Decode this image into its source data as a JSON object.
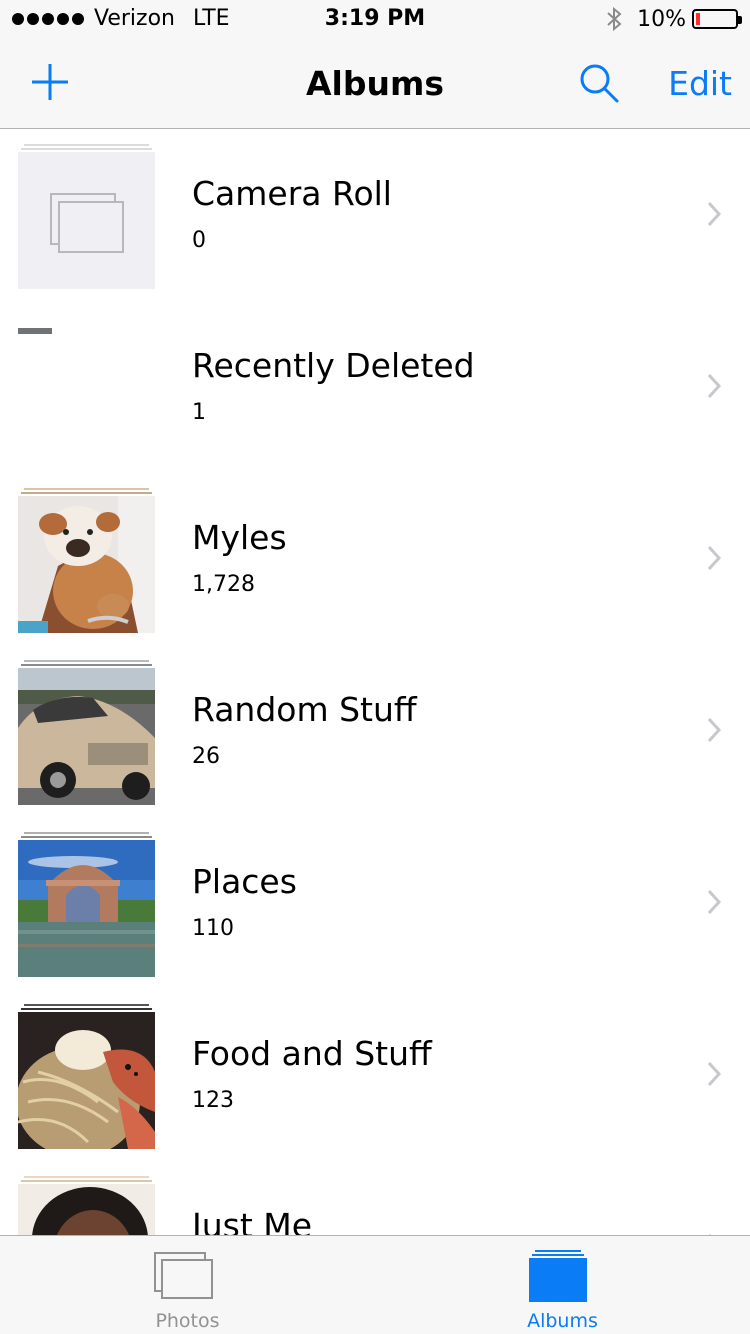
{
  "status_bar": {
    "carrier": "Verizon",
    "network": "LTE",
    "time": "3:19 PM",
    "battery": "10%",
    "battery_level": 0.1,
    "signal_bars": 5
  },
  "nav": {
    "title": "Albums",
    "edit_label": "Edit",
    "add_icon": "plus-icon",
    "search_icon": "search-icon"
  },
  "albums": [
    {
      "name": "Camera Roll",
      "count": "0",
      "thumbnail": "empty-placeholder"
    },
    {
      "name": "Recently Deleted",
      "count": "1",
      "thumbnail": "blank"
    },
    {
      "name": "Myles",
      "count": "1,728",
      "thumbnail": "bulldog-puppy-photo"
    },
    {
      "name": "Random Stuff",
      "count": "26",
      "thumbnail": "silver-car-photo"
    },
    {
      "name": "Places",
      "count": "110",
      "thumbnail": "domed-building-by-water-photo"
    },
    {
      "name": "Food and Stuff",
      "count": "123",
      "thumbnail": "noodles-and-crab-photo"
    },
    {
      "name": "Just Me",
      "count": "",
      "thumbnail": "portrait-photo"
    }
  ],
  "tabs": [
    {
      "label": "Photos",
      "selected": false
    },
    {
      "label": "Albums",
      "selected": true
    }
  ],
  "colors": {
    "accent": "#0a7cf5",
    "bar_background": "#f7f7f7",
    "inactive_tab": "#929292",
    "battery_low": "#ff2d2d"
  }
}
